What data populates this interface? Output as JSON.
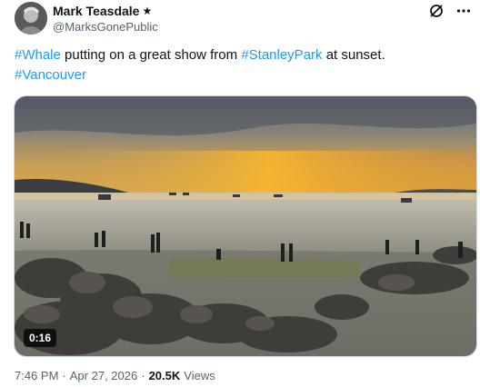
{
  "author": {
    "display_name": "Mark Teasdale",
    "badge": "★",
    "handle": "@MarksGonePublic"
  },
  "header_icons": [
    "grok-icon",
    "more-icon"
  ],
  "tweet": {
    "hashtag_1": "#Whale",
    "text_1": " putting on a great show from ",
    "hashtag_2": "#StanleyPark",
    "text_2": " at sunset.",
    "hashtag_3": "#Vancouver"
  },
  "video": {
    "duration": "0:16"
  },
  "meta": {
    "time": "7:46 PM",
    "sep1": "·",
    "date": "Apr 27, 2026",
    "sep2": "·",
    "views_count": "20.5K",
    "views_label": "Views"
  },
  "colors": {
    "link": "#1d9bf0",
    "text": "#0f1419",
    "secondary": "#536471"
  }
}
